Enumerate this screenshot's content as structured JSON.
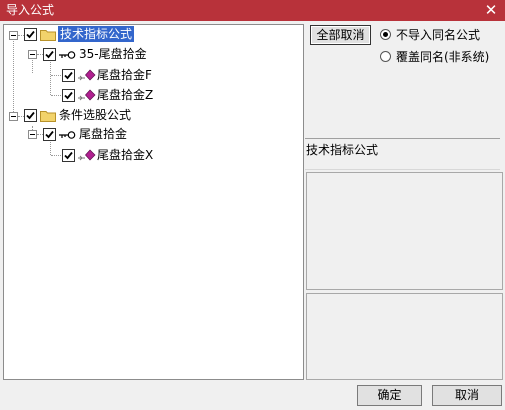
{
  "window": {
    "title": "导入公式",
    "close_glyph": "✕"
  },
  "tree": {
    "root1": {
      "label": "技术指标公式",
      "checked": true
    },
    "group1": {
      "label": "35-尾盘拾金",
      "checked": true
    },
    "leaf1": {
      "label": "尾盘拾金F",
      "checked": true
    },
    "leaf2": {
      "label": "尾盘拾金Z",
      "checked": true
    },
    "root2": {
      "label": "条件选股公式",
      "checked": true
    },
    "group2": {
      "label": "尾盘拾金",
      "checked": true
    },
    "leaf3": {
      "label": "尾盘拾金X",
      "checked": true
    }
  },
  "controls": {
    "cancel_all_label": "全部取消",
    "option_no_import": "不导入同名公式",
    "option_overwrite": "覆盖同名(非系统)",
    "selected_option": "option_no_import",
    "info_title": "技术指标公式"
  },
  "footer": {
    "ok_label": "确定",
    "cancel_label": "取消"
  },
  "colors": {
    "titlebar": "#b8323a",
    "selection": "#3366cc",
    "folder": "#f2d36b",
    "leaf_diamond": "#b02090"
  },
  "icons": [
    "close-icon",
    "folder-icon",
    "key-icon",
    "formula-leaf-icon",
    "checkmark-icon"
  ]
}
